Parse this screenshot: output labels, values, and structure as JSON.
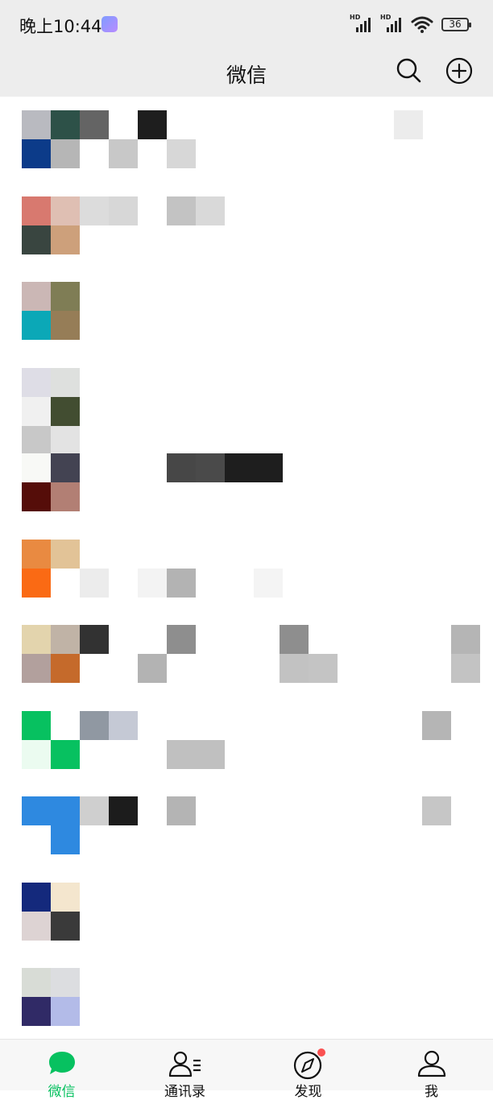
{
  "status_bar": {
    "time": "晚上10:44",
    "battery": "36",
    "signal_label_1": "HD",
    "signal_label_2": "HD"
  },
  "nav": {
    "title": "微信",
    "search_icon": "search-icon",
    "add_icon": "plus-circle-icon"
  },
  "chats": [
    {
      "avatar_colors": [
        "#b9bac0",
        "#2d5148",
        "#0c3b89",
        "#b6b6b6"
      ]
    },
    {
      "avatar_colors": [
        "#d8796f",
        "#dfbfb3",
        "#394540",
        "#cda07b"
      ]
    },
    {
      "avatar_colors": [
        "#cbb7b5",
        "#7f7d55",
        "#0ba8b7",
        "#967d57"
      ]
    },
    {
      "avatar_colors": [
        "#dedde6",
        "#dee0de",
        "#f0f0f0",
        "#424d31",
        "#c8c8c8",
        "#e3e3e3"
      ]
    },
    {
      "avatar_colors": [
        "#f8f9f6",
        "#434352",
        "#550d09",
        "#b27f74"
      ]
    },
    {
      "avatar_colors": [
        "#e98a41",
        "#e2c397",
        "#fa6a14",
        "#ffffff"
      ]
    },
    {
      "avatar_colors": [
        "#e3d4ad",
        "#c0b3a6",
        "#b2a09d",
        "#c56a2b"
      ]
    },
    {
      "avatar_colors": [
        "#07c160",
        "#ffffff",
        "#ebfbf0",
        "#07c160"
      ]
    },
    {
      "avatar_colors": [
        "#2e89e0",
        "#2e89e0",
        "#ffffff",
        "#2e89e0"
      ]
    },
    {
      "avatar_colors": [
        "#14297c",
        "#f4e6ce",
        "#ddd3d3",
        "#3a3a3a"
      ]
    },
    {
      "avatar_colors": [
        "#d8dcd6",
        "#dcdde0",
        "#302a66",
        "#b3bbe8"
      ]
    }
  ],
  "tabs": [
    {
      "label": "微信",
      "icon": "chat-bubble-icon",
      "active": true
    },
    {
      "label": "通讯录",
      "icon": "contacts-icon",
      "active": false
    },
    {
      "label": "发现",
      "icon": "compass-icon",
      "active": false
    },
    {
      "label": "我",
      "icon": "person-icon",
      "active": false
    }
  ],
  "colors": {
    "accent": "#07c160",
    "header_bg": "#ededed",
    "badge": "#fa5151"
  }
}
